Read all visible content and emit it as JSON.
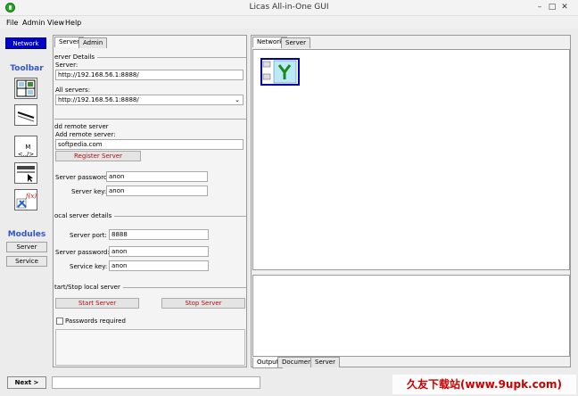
{
  "window": {
    "title": "Licas All-in-One GUI",
    "minimize": "–",
    "maximize": "□",
    "close": "✕"
  },
  "menu": [
    "File",
    "Admin",
    "View",
    "Help"
  ],
  "left": {
    "network_button": "Network",
    "toolbar_heading": "Toolbar",
    "tool3_label": "M\n<../>",
    "modules_heading": "Modules",
    "modules": [
      "Server",
      "Service"
    ]
  },
  "middle": {
    "tabs": [
      "Server",
      "Admin"
    ],
    "server_details": {
      "legend": "erver Details",
      "server_label": "Server:",
      "server_value": "http://192.168.56.1:8888/",
      "all_servers_label": "All servers:",
      "all_servers_value": "http://192.168.56.1:8888/"
    },
    "add_remote": {
      "legend": "dd remote server",
      "add_label": "Add remote server:",
      "add_value": "softpedia.com",
      "register_button": "Register Server",
      "password_label": "Server password:",
      "password_value": "anon",
      "key_label": "Server key:",
      "key_value": "anon"
    },
    "local_details": {
      "legend": "ocal server details",
      "port_label": "Server port:",
      "port_value": "8888",
      "password_label": "Server password:",
      "password_value": "anon",
      "service_key_label": "Service key:",
      "service_key_value": "anon"
    },
    "start_stop": {
      "legend": "tart/Stop local server",
      "start_button": "Start Server",
      "stop_button": "Stop Server",
      "passwords_required": "Passwords required"
    }
  },
  "right": {
    "top_tabs": [
      "Network",
      "Server"
    ],
    "bottom_tabs": [
      "Output",
      "Document",
      "Server"
    ]
  },
  "bottom": {
    "next_button": "Next >",
    "watermark": "久友下载站(www.9upk.com)"
  }
}
